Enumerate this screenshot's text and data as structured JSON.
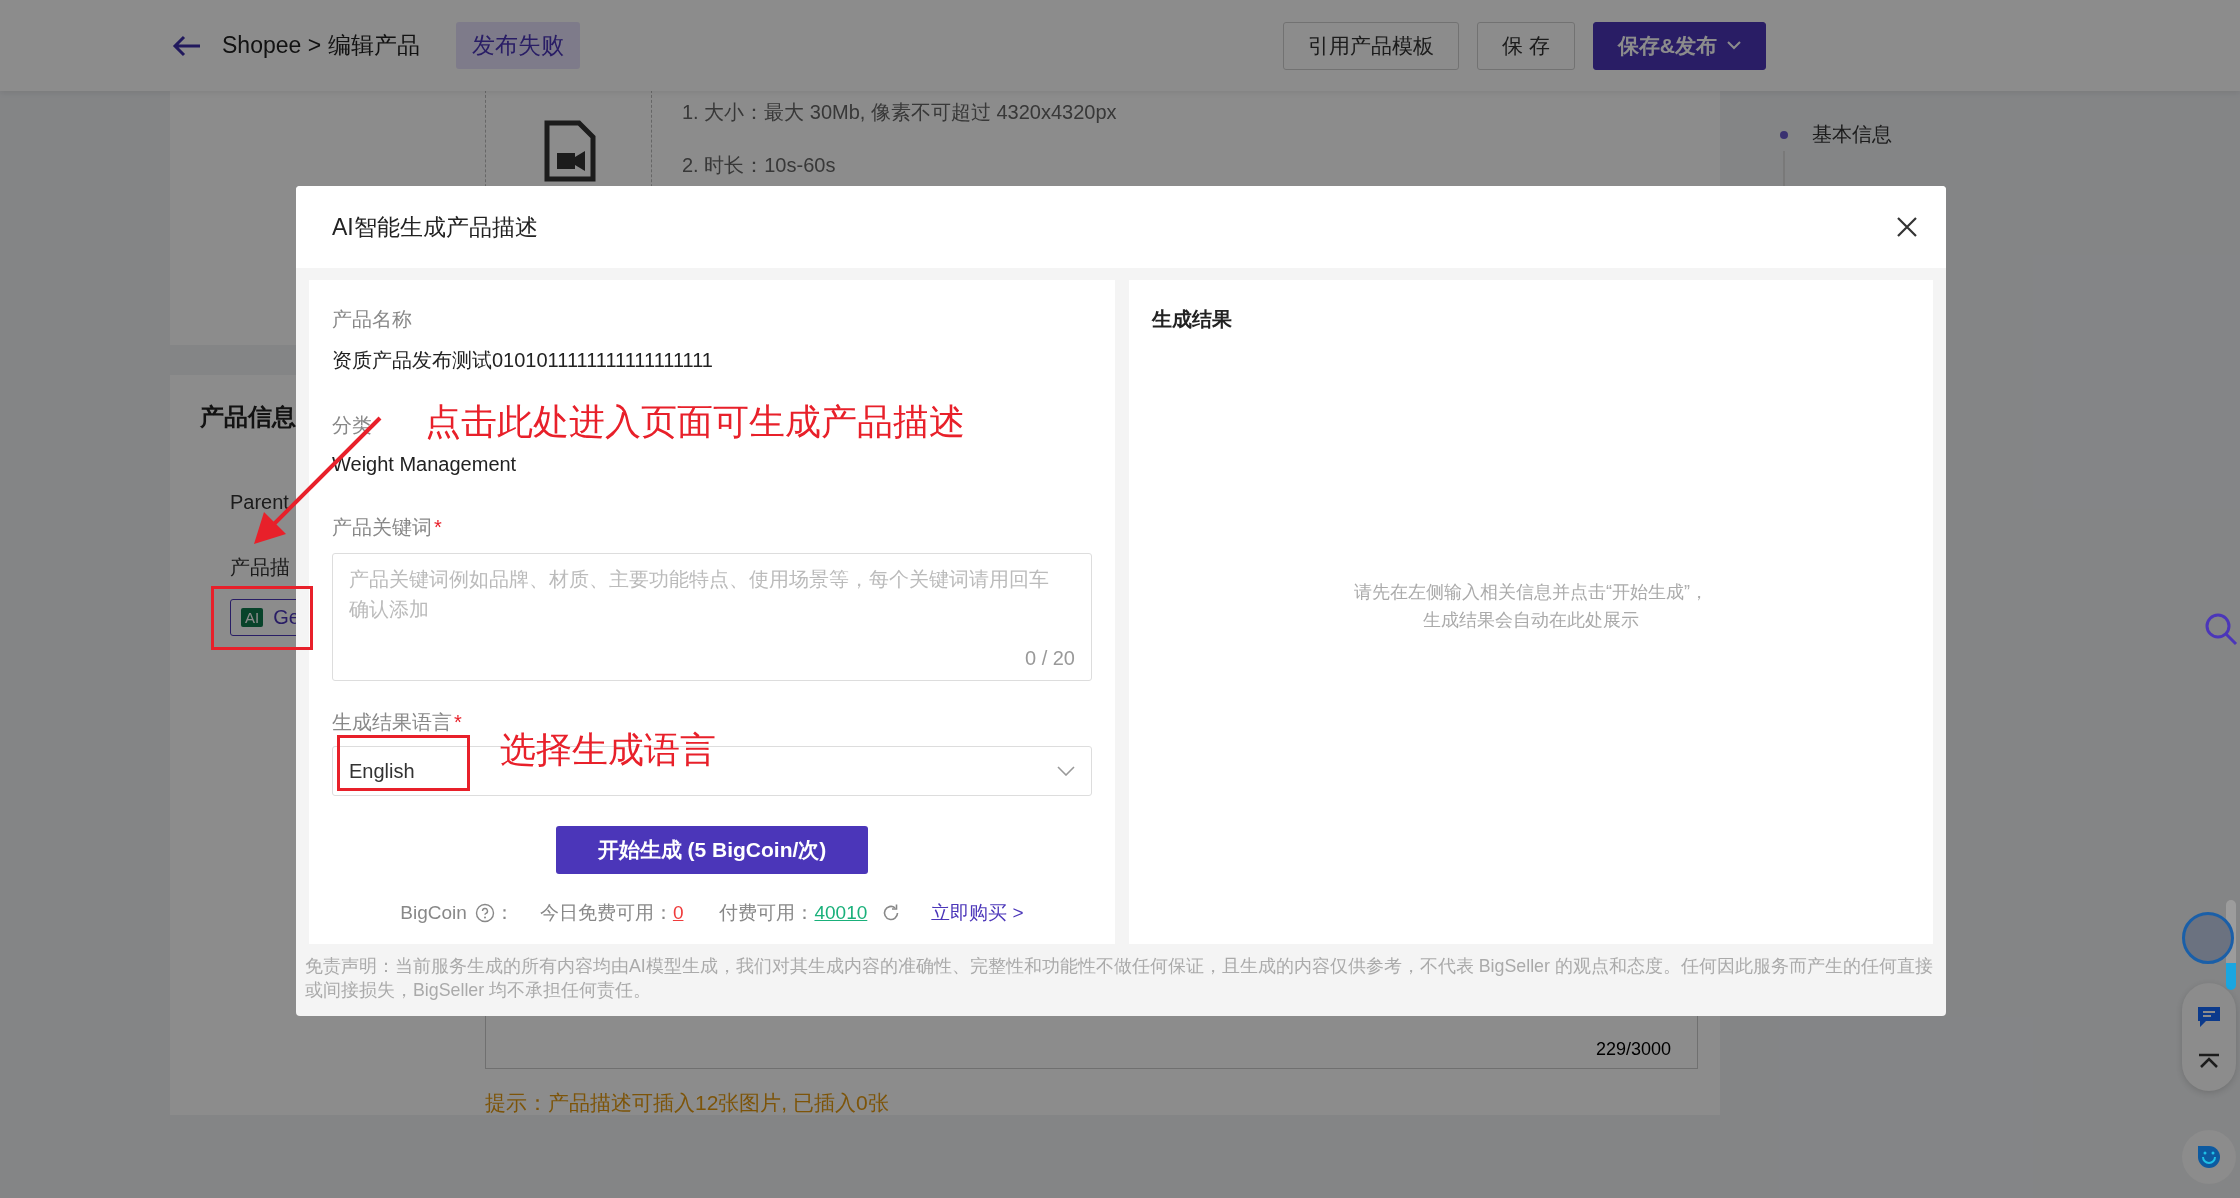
{
  "header": {
    "breadcrumb": "Shopee > 编辑产品",
    "status_badge": "发布失败",
    "buttons": [
      {
        "label": "引用产品模板",
        "kind": "default"
      },
      {
        "label": "保 存",
        "kind": "default"
      },
      {
        "label": "保存&发布",
        "kind": "primary"
      }
    ]
  },
  "media_section": {
    "rules": [
      "1. 大小：最大 30Mb, 像素不可超过 4320x4320px",
      "2. 时长：10s-60s"
    ]
  },
  "side_nav": [
    {
      "label": "基本信息"
    }
  ],
  "product_info": {
    "title": "产品信息",
    "parent_label": "Parent",
    "description_label": "产品描",
    "ai_badge": "AI",
    "ai_button": "Ge",
    "char_count": "229/3000",
    "hint": "提示：产品描述可插入12张图片, 已插入0张"
  },
  "modal": {
    "title": "AI智能生成产品描述",
    "form": {
      "name_label": "产品名称",
      "name_value": "资质产品发布测试0101011111111111111111",
      "category_label": "分类",
      "category_value": "Weight Management",
      "keywords": {
        "label": "产品关键词",
        "required_mark": "*",
        "placeholder": "产品关键词例如品牌、材质、主要功能特点、使用场景等，每个关键词请用回车确认添加",
        "counter": "0 / 20"
      },
      "language": {
        "label": "生成结果语言",
        "required_mark": "*",
        "value": "English"
      },
      "generate_button": "开始生成 (5 BigCoin/次)",
      "bigcoin": {
        "label": "BigCoin",
        "separator": "：",
        "free_label": "今日免费可用：",
        "free_value": "0",
        "paid_label": "付费可用：",
        "paid_value": "40010",
        "buy_link": "立即购买 >"
      }
    },
    "result": {
      "title": "生成结果",
      "empty_lines": [
        "请先在左侧输入相关信息并点击“开始生成”，",
        "生成结果会自动在此处展示"
      ]
    },
    "disclaimer": "免责声明：当前服务生成的所有内容均由AI模型生成，我们对其生成内容的准确性、完整性和功能性不做任何保证，且生成的内容仅供参考，不代表 BigSeller 的观点和态度。任何因此服务而产生的任何直接或间接损失，BigSeller 均不承担任何责任。"
  },
  "annotations": [
    {
      "text": "点击此处进入页面可生成产品描述"
    },
    {
      "text": "选择生成语言"
    }
  ]
}
